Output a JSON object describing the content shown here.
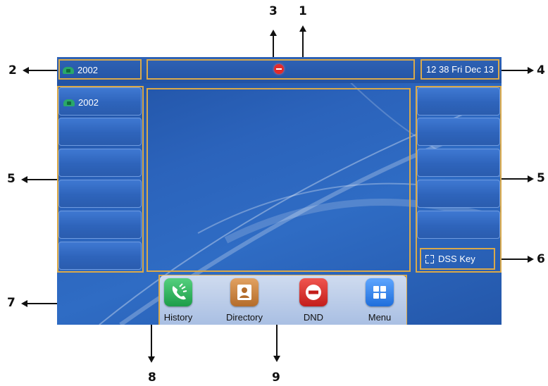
{
  "status_bar": {
    "account": "2002",
    "datetime": "12 38 Fri Dec 13"
  },
  "line_keys": [
    {
      "label": "2002"
    },
    {
      "label": ""
    },
    {
      "label": ""
    },
    {
      "label": ""
    },
    {
      "label": ""
    },
    {
      "label": ""
    }
  ],
  "right_keys": [
    {
      "label": ""
    },
    {
      "label": ""
    },
    {
      "label": ""
    },
    {
      "label": ""
    },
    {
      "label": ""
    }
  ],
  "dss_key": "DSS Key",
  "softkeys": [
    {
      "label": "History",
      "icon": "history-icon",
      "color": "#2fae5a"
    },
    {
      "label": "Directory",
      "icon": "directory-icon",
      "color": "#c98240"
    },
    {
      "label": "DND",
      "icon": "dnd-icon",
      "color": "#dc332e"
    },
    {
      "label": "Menu",
      "icon": "menu-icon",
      "color": "#2f86ee"
    }
  ],
  "callouts": [
    "1",
    "2",
    "3",
    "4",
    "5",
    "5",
    "6",
    "7",
    "8",
    "9"
  ],
  "colors": {
    "frame": "#d9a94a",
    "screen": "#2b63bb"
  }
}
